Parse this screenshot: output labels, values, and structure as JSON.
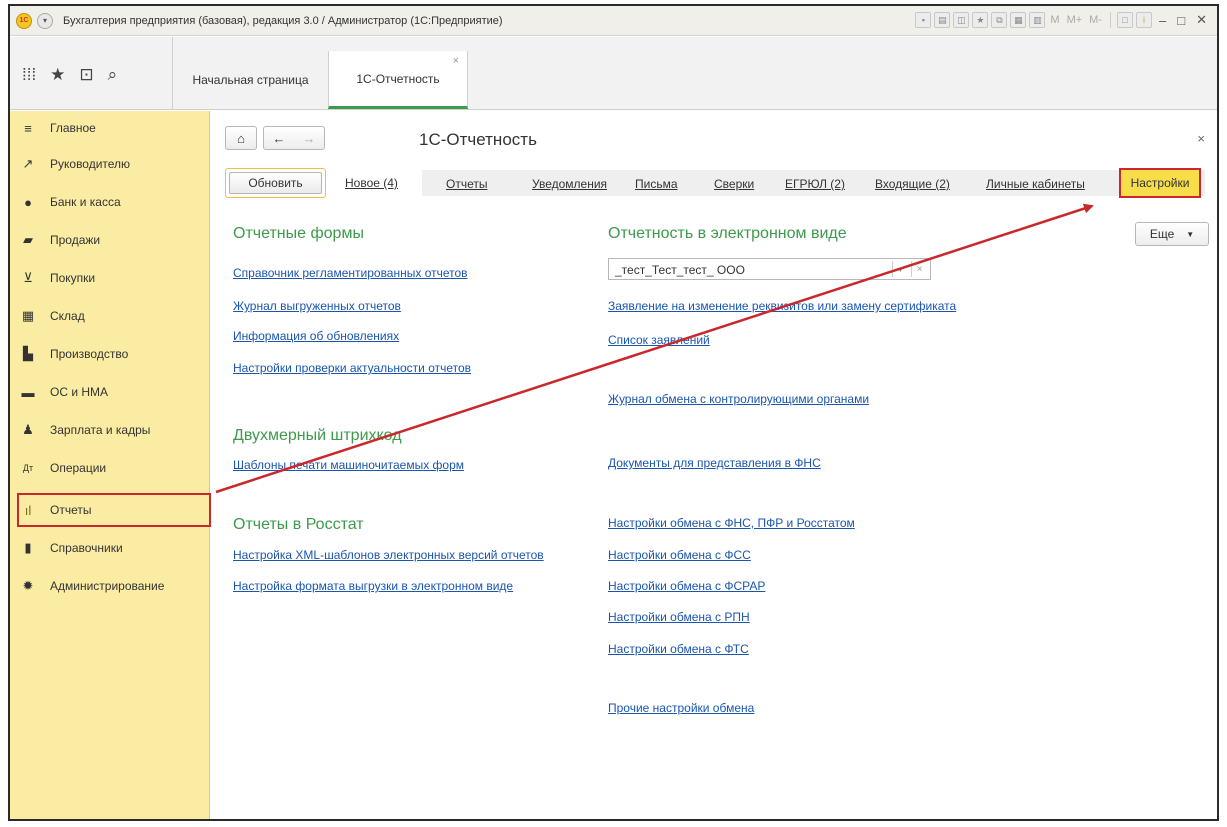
{
  "window": {
    "title": "Бухгалтерия предприятия (базовая), редакция 3.0 / Администратор  (1С:Предприятие)",
    "logo_text": "1С",
    "toolbar_text": [
      "M",
      "M+",
      "M-"
    ]
  },
  "tabs": [
    {
      "label": "Начальная страница"
    },
    {
      "label": "1С-Отчетность",
      "close": "×"
    }
  ],
  "sidebar": {
    "items": [
      {
        "label": "Главное",
        "icon": "menu-icon"
      },
      {
        "label": "Руководителю",
        "icon": "chart-line-icon"
      },
      {
        "label": "Банк и касса",
        "icon": "ruble-icon"
      },
      {
        "label": "Продажи",
        "icon": "bag-icon"
      },
      {
        "label": "Покупки",
        "icon": "cart-icon"
      },
      {
        "label": "Склад",
        "icon": "warehouse-icon"
      },
      {
        "label": "Производство",
        "icon": "factory-icon"
      },
      {
        "label": "ОС и НМА",
        "icon": "truck-icon"
      },
      {
        "label": "Зарплата и кадры",
        "icon": "person-icon"
      },
      {
        "label": "Операции",
        "icon": "operations-icon"
      },
      {
        "label": "Отчеты",
        "icon": "bar-chart-icon"
      },
      {
        "label": "Справочники",
        "icon": "book-icon"
      },
      {
        "label": "Администрирование",
        "icon": "gear-icon"
      }
    ]
  },
  "page": {
    "title": "1С-Отчетность",
    "close": "×",
    "refresh_label": "Обновить",
    "new_label": "Новое (4)",
    "nav_links": [
      "Отчеты",
      "Уведомления",
      "Письма",
      "Сверки",
      "ЕГРЮЛ (2)",
      "Входящие (2)",
      "Личные кабинеты"
    ],
    "settings_label": "Настройки",
    "more_label": "Еще",
    "more_arrow": "▼"
  },
  "left": {
    "forms_title": "Отчетные формы",
    "forms_links": [
      "Справочник регламентированных отчетов",
      "Журнал выгруженных отчетов",
      "Информация об обновлениях",
      "Настройки проверки актуальности отчетов"
    ],
    "barcode_title": "Двухмерный штрихкод",
    "barcode_links": [
      "Шаблоны печати машиночитаемых форм"
    ],
    "rosstat_title": "Отчеты в Росстат",
    "rosstat_links": [
      "Настройка XML-шаблонов электронных версий отчетов",
      "Настройка формата выгрузки в электронном виде"
    ]
  },
  "right": {
    "title": "Отчетность в электронном виде",
    "org_value": "_тест_Тест_тест_ ООО",
    "links": [
      "Заявление на изменение реквизитов или замену сертификата",
      "Список заявлений",
      "Журнал обмена с контролирующими органами",
      "Документы для представления в ФНС",
      "Настройки обмена с ФНС, ПФР и Росстатом",
      "Настройки обмена с ФСС",
      "Настройки обмена с ФСРАР",
      "Настройки обмена с РПН",
      "Настройки обмена с ФТС",
      "Прочие настройки обмена"
    ]
  },
  "colors": {
    "sidebar_bg": "#fbeca3",
    "section_title": "#3c9a4a",
    "link": "#1a55b0",
    "highlight_border": "#c9282d",
    "settings_bg": "#f8dd4a",
    "arrow": "#c9282d"
  }
}
